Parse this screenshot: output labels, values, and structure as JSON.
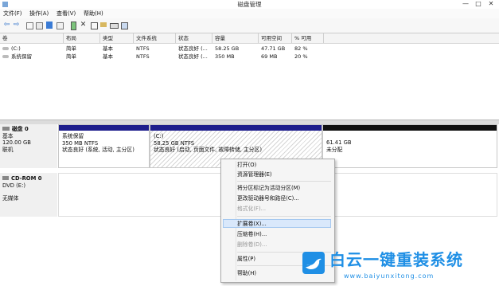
{
  "window": {
    "title": "磁盘管理",
    "minimize": "—",
    "maximize": "□",
    "close": "✕"
  },
  "menu": [
    "文件(F)",
    "操作(A)",
    "查看(V)",
    "帮助(H)"
  ],
  "toolbar": {
    "back": "⇦",
    "forward": "⇨"
  },
  "volumes": {
    "columns": [
      "卷",
      "布局",
      "类型",
      "文件系统",
      "状态",
      "容量",
      "可用空间",
      "% 可用"
    ],
    "rows": [
      [
        "(C:)",
        "简单",
        "基本",
        "NTFS",
        "状态良好 (...",
        "58.25 GB",
        "47.71 GB",
        "82 %"
      ],
      [
        "系统保留",
        "简单",
        "基本",
        "NTFS",
        "状态良好 (...",
        "350 MB",
        "69 MB",
        "20 %"
      ]
    ]
  },
  "disk0": {
    "name": "磁盘 0",
    "type": "基本",
    "size": "120.00 GB",
    "status": "联机",
    "partitions": [
      {
        "name": "系统保留",
        "size": "350 MB NTFS",
        "status": "状态良好 (系统, 活动, 主分区)",
        "color": "#1e1e8c"
      },
      {
        "name": "(C:)",
        "size": "58.25 GB NTFS",
        "status": "状态良好 (启动, 页面文件, 故障转储, 主分区)",
        "color": "#1e1e8c"
      },
      {
        "name": "",
        "size": "61.41 GB",
        "status": "未分配",
        "color": "#111111"
      }
    ]
  },
  "cdrom0": {
    "name": "CD-ROM 0",
    "drive": "DVD (E:)",
    "media": "无媒体"
  },
  "context_menu": {
    "items": [
      "打开(O)",
      "资源管理器(E)",
      "将分区标记为活动分区(M)",
      "更改驱动器号和路径(C)...",
      "格式化(F)...",
      "扩展卷(X)...",
      "压缩卷(H)...",
      "删除卷(D)...",
      "属性(P)",
      "帮助(H)"
    ]
  },
  "watermark": {
    "brand": "白云一键重装系统",
    "url": "www.baiyunxitong.com"
  }
}
